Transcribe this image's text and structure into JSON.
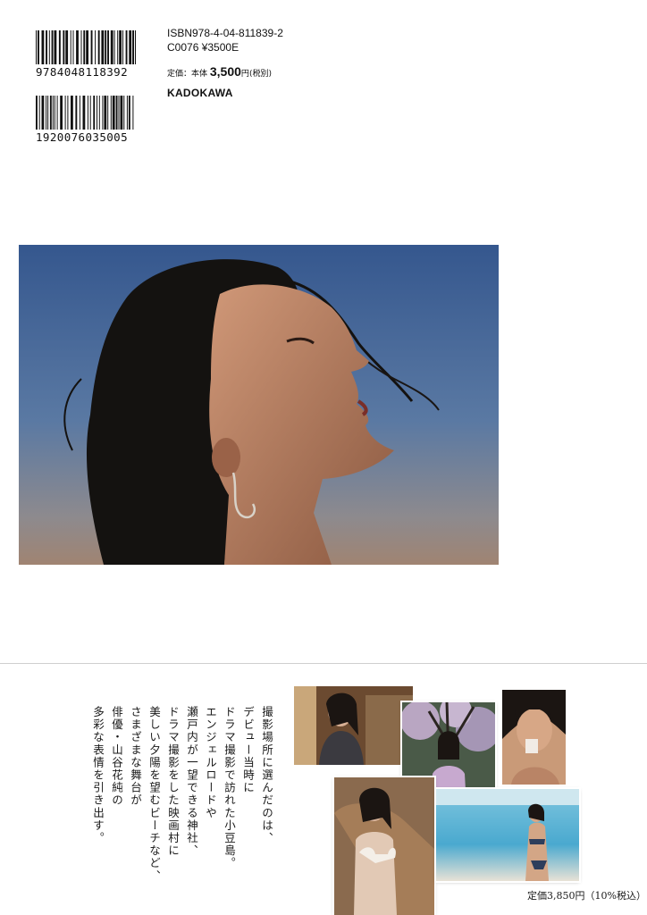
{
  "barcodes": {
    "top_number": "9784048118392",
    "bottom_number": "1920076035005"
  },
  "isbn": {
    "isbn_line": "ISBN978-4-04-811839-2",
    "code_line": "C0076 ¥3500E"
  },
  "price": {
    "label": "定価：本体 ",
    "amount": "3,500",
    "suffix": "円",
    "tax_note": "(税別)"
  },
  "publisher": "KADOKAWA",
  "description": {
    "lines": [
      "撮影場所に選んだのは、",
      "デビュー当時に",
      "ドラマ撮影で訪れた小豆島。",
      "エンジェルロードや",
      "瀬戸内が一望できる神社、",
      "ドラマ撮影をした映画村に",
      "美しい夕陽を望むビーチなど、",
      "さまざまな舞台が",
      "俳優・山谷花純の",
      "多彩な表情を引き出す。"
    ]
  },
  "bottom_price": "定価3,850円（10%税込）",
  "colors": {
    "sky_top": "#3a5f9a",
    "sky_bottom": "#9a8578",
    "hair": "#141210",
    "skin": "#c58a6a"
  }
}
